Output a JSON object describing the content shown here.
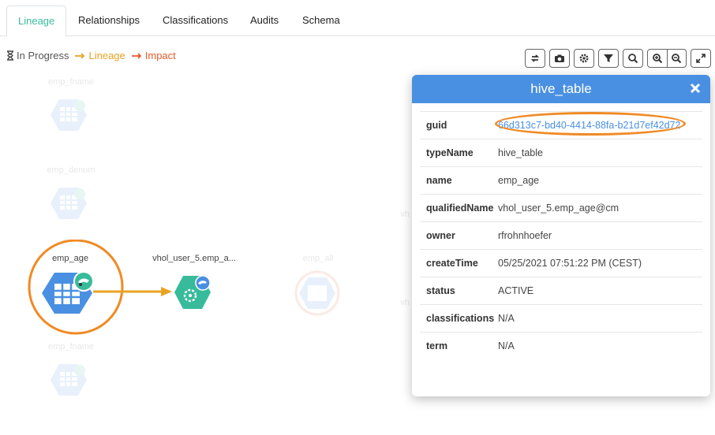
{
  "tabs": [
    {
      "label": "Lineage",
      "active": true
    },
    {
      "label": "Relationships",
      "active": false
    },
    {
      "label": "Classifications",
      "active": false
    },
    {
      "label": "Audits",
      "active": false
    },
    {
      "label": "Schema",
      "active": false
    }
  ],
  "legend": {
    "in_progress": "In Progress",
    "lineage": "Lineage",
    "impact": "Impact"
  },
  "toolbar": {
    "icons": [
      "refresh-icon",
      "camera-icon",
      "gear-icon",
      "filter-icon",
      "search-icon",
      "zoom-in-icon",
      "zoom-out-icon",
      "fullscreen-icon"
    ]
  },
  "graph": {
    "nodes": {
      "emp_fname_top": "emp_fname",
      "emp_denum": "emp_denum",
      "emp_age": "emp_age",
      "process": "vhol_user_5.emp_a...",
      "emp_all": "emp_all",
      "emp_fname_bottom": "emp_fname",
      "partial_vh_1": "vh",
      "partial_vh_2": "vh"
    }
  },
  "panel": {
    "title": "hive_table",
    "rows": [
      {
        "key": "guid",
        "value": "66d313c7-bd40-4414-88fa-b21d7ef42d72"
      },
      {
        "key": "typeName",
        "value": "hive_table"
      },
      {
        "key": "name",
        "value": "emp_age"
      },
      {
        "key": "qualifiedName",
        "value": "vhol_user_5.emp_age@cm"
      },
      {
        "key": "owner",
        "value": "rfrohnhoefer"
      },
      {
        "key": "createTime",
        "value": "05/25/2021 07:51:22 PM (CEST)"
      },
      {
        "key": "status",
        "value": "ACTIVE"
      },
      {
        "key": "classifications",
        "value": "N/A"
      },
      {
        "key": "term",
        "value": "N/A"
      }
    ]
  },
  "colors": {
    "accent_green": "#38bb9b",
    "header_blue": "#4a90e2",
    "lineage_orange": "#e8a323",
    "impact_red": "#e65b2c",
    "highlight_ring": "#f08a24"
  }
}
